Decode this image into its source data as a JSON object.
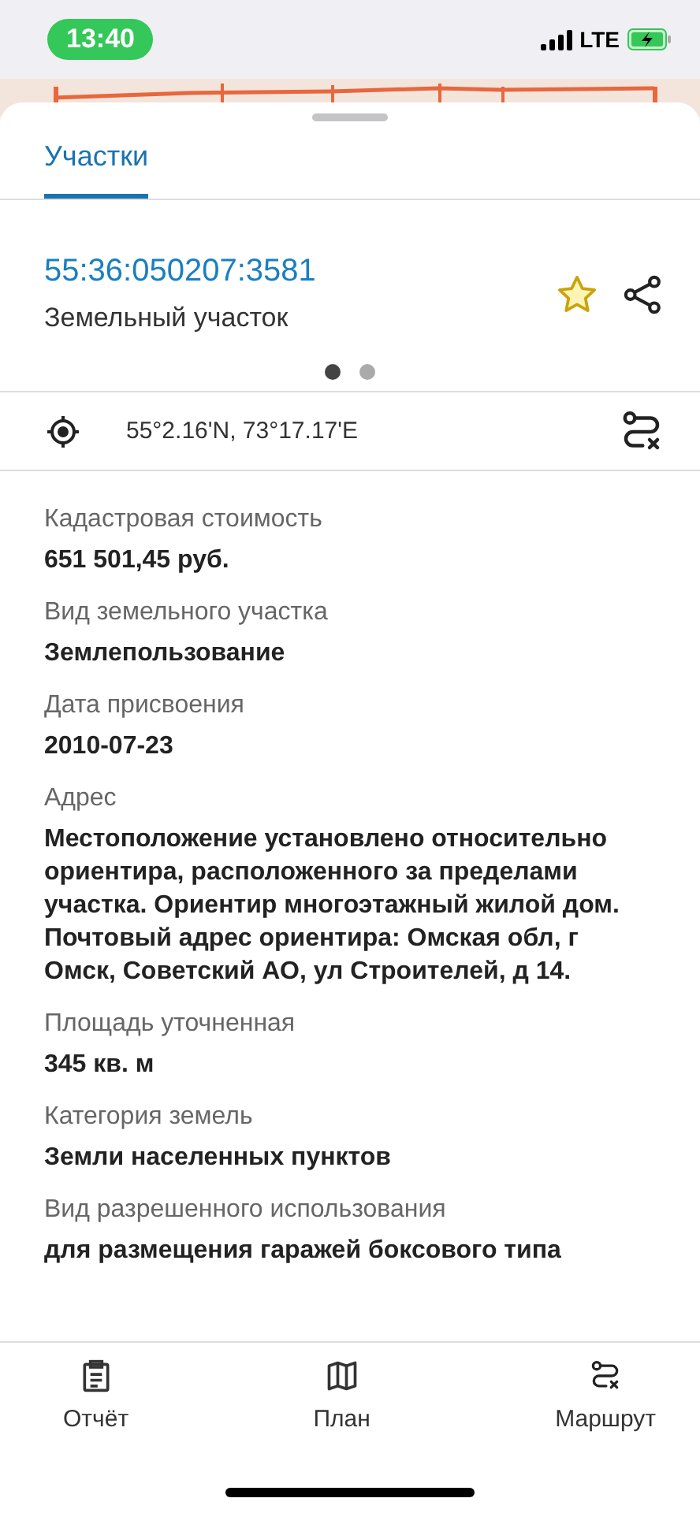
{
  "status_bar": {
    "time": "13:40",
    "network": "LTE"
  },
  "tabs": [
    {
      "label": "Участки",
      "selected": true
    }
  ],
  "parcel": {
    "number": "55:36:050207:3581",
    "type": "Земельный участок"
  },
  "pager": [
    {
      "selected": true
    },
    {
      "selected": false
    }
  ],
  "coordinates": "55°2.16'N, 73°17.17'E",
  "fields": [
    {
      "label": "Кадастровая стоимость",
      "value": "651 501,45 руб."
    },
    {
      "label": "Вид земельного участка",
      "value": "Землепользование"
    },
    {
      "label": "Дата присвоения",
      "value": "2010-07-23"
    },
    {
      "label": "Адрес",
      "value": "Местоположение установлено относительно ориентира, расположенного за пределами участка. Ориентир многоэтажный жилой дом. Почтовый адрес ориентира: Омская обл, г Омск, Советский АО, ул Строителей, д 14."
    },
    {
      "label": "Площадь уточненная",
      "value": "345 кв. м"
    },
    {
      "label": "Категория земель",
      "value": "Земли населенных пунктов"
    },
    {
      "label": "Вид разрешенного использования",
      "value": "для размещения гаражей боксового типа"
    }
  ],
  "bottom_nav": [
    {
      "kind": "report",
      "label": "Отчёт"
    },
    {
      "kind": "plan",
      "label": "План"
    },
    {
      "kind": "route",
      "label": "Маршрут"
    }
  ]
}
